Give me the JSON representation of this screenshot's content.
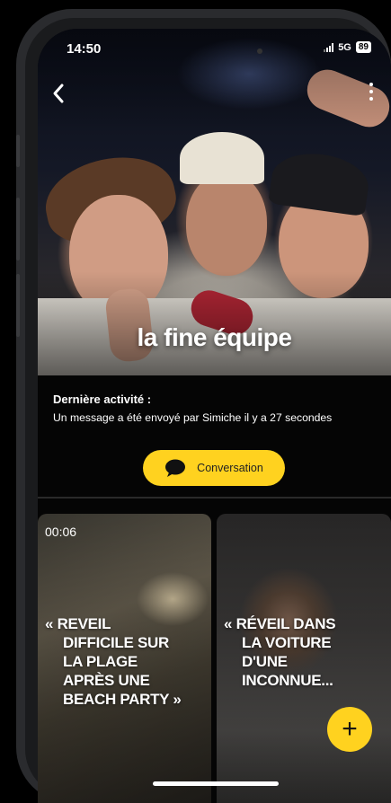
{
  "status_bar": {
    "time": "14:50",
    "network": "5G",
    "battery": "89"
  },
  "header": {
    "back": "back",
    "more": "more options"
  },
  "group": {
    "title": "la fine équipe"
  },
  "activity": {
    "label": "Dernière activité :",
    "text": "Un message a été envoyé par Simiche il y a 27 secondes"
  },
  "conversation_button": {
    "label": "Conversation"
  },
  "stories": [
    {
      "duration": "00:06",
      "title_lines": [
        "« REVEIL",
        "DIFFICILE SUR",
        "LA PLAGE",
        "APRÈS UNE",
        "BEACH PARTY  »"
      ]
    },
    {
      "duration": "",
      "title_lines": [
        "« RÉVEIL DANS",
        "LA VOITURE",
        "D'UNE",
        "INCONNUE..."
      ]
    }
  ],
  "fab": {
    "label": "+"
  },
  "colors": {
    "accent": "#ffd21f",
    "background": "#050505"
  },
  "icons": [
    "chevron-left-icon",
    "more-vertical-icon",
    "chat-bubble-icon",
    "plus-icon"
  ]
}
